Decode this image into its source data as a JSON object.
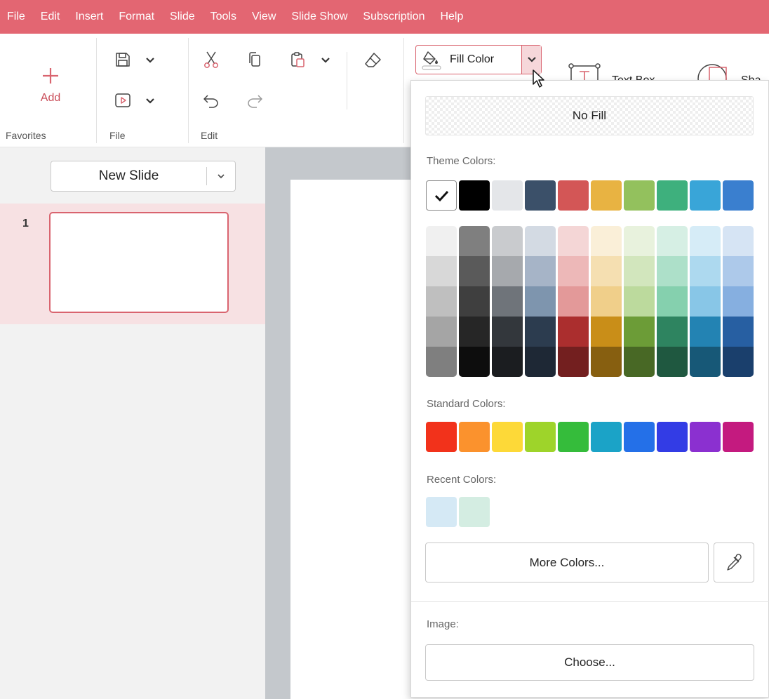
{
  "menu": [
    "File",
    "Edit",
    "Insert",
    "Format",
    "Slide",
    "Tools",
    "View",
    "Slide Show",
    "Subscription",
    "Help"
  ],
  "ribbon": {
    "add_label": "Add",
    "groups": {
      "favorites": "Favorites",
      "file": "File",
      "edit": "Edit"
    },
    "fill_color_label": "Fill Color",
    "text_box_label": "Text Box",
    "shape_label_partial": "Sha"
  },
  "left_panel": {
    "new_slide_label": "New Slide",
    "slide_number": "1"
  },
  "fill_dropdown": {
    "no_fill_label": "No Fill",
    "theme_colors_title": "Theme Colors:",
    "theme_colors": [
      "#ffffff",
      "#000000",
      "#e4e6e9",
      "#3b5069",
      "#d35656",
      "#e8b342",
      "#93c15d",
      "#3eb07d",
      "#39a5d8",
      "#3a7fcf"
    ],
    "selected_theme_index": 0,
    "shades": [
      [
        "#f0f0f0",
        "#d8d8d8",
        "#bfbfbf",
        "#a5a5a5",
        "#7f7f7f"
      ],
      [
        "#7f7f7f",
        "#5a5a5a",
        "#3f3f3f",
        "#262626",
        "#0d0d0d"
      ],
      [
        "#c9cbce",
        "#a6a9ad",
        "#6f747a",
        "#33373c",
        "#1b1d20"
      ],
      [
        "#d3dae3",
        "#a6b4c7",
        "#7e95ae",
        "#2c3c4f",
        "#1e2835"
      ],
      [
        "#f4d6d6",
        "#edb8b8",
        "#e39999",
        "#ab2e2e",
        "#731f1f"
      ],
      [
        "#faefd8",
        "#f5dfb1",
        "#f0cf8a",
        "#c98e18",
        "#875f10"
      ],
      [
        "#e8f2dd",
        "#d2e6bd",
        "#bcda9d",
        "#6c9c37",
        "#486825"
      ],
      [
        "#d6efe4",
        "#ade0c9",
        "#85d0ae",
        "#2e8460",
        "#1f5840"
      ],
      [
        "#d6ecf7",
        "#add9ef",
        "#88c6e7",
        "#2383b3",
        "#175877"
      ],
      [
        "#d6e4f4",
        "#adc9ea",
        "#86afe0",
        "#275fa2",
        "#1a3f6c"
      ]
    ],
    "standard_colors_title": "Standard Colors:",
    "standard_colors": [
      "#f2321b",
      "#fb922d",
      "#fdd938",
      "#9ed42a",
      "#35bc3b",
      "#1ba3c7",
      "#2470e8",
      "#333ce5",
      "#8b30d0",
      "#c41a7f"
    ],
    "recent_colors_title": "Recent Colors:",
    "recent_colors": [
      "#d5e9f5",
      "#d4ede2"
    ],
    "more_colors_label": "More Colors...",
    "image_title": "Image:",
    "choose_label": "Choose..."
  },
  "colors": {
    "accent": "#e36672",
    "accent_border": "#d9646f",
    "selection_bg": "#f7e1e3",
    "canvas_bg": "#c4c8cc"
  },
  "icons": [
    "add-icon",
    "save-icon",
    "chevron-down-icon",
    "present-icon",
    "cut-icon",
    "copy-icon",
    "paste-icon",
    "undo-icon",
    "redo-icon",
    "eraser-icon",
    "fill-bucket-icon",
    "text-box-icon",
    "shape-icon",
    "checkmark-icon",
    "eyedropper-icon",
    "mouse-cursor-icon"
  ]
}
